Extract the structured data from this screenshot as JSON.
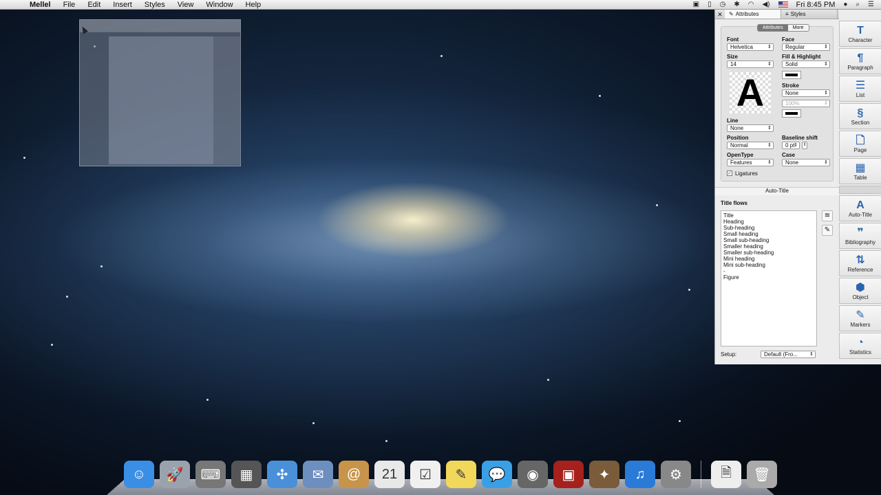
{
  "menubar": {
    "apple": "",
    "app_name": "Mellel",
    "menus": [
      "File",
      "Edit",
      "Insert",
      "Styles",
      "View",
      "Window",
      "Help"
    ],
    "clock": "Fri 8:45 PM"
  },
  "palette": {
    "tabs": {
      "attributes": "Attributes",
      "styles": "Styles"
    },
    "segment": {
      "attributes": "Attributes",
      "more": "More"
    },
    "font": {
      "label": "Font",
      "value": "Helvetica"
    },
    "face": {
      "label": "Face",
      "value": "Regular"
    },
    "size": {
      "label": "Size",
      "value": "14"
    },
    "fill": {
      "label": "Fill & Highlight",
      "value": "Solid"
    },
    "preview_letter": "A",
    "stroke": {
      "label": "Stroke",
      "value": "None",
      "percent": "100%"
    },
    "line": {
      "label": "Line",
      "value": "None"
    },
    "position": {
      "label": "Position",
      "value": "Normal"
    },
    "baseline": {
      "label": "Baseline shift",
      "value": "0 pt"
    },
    "opentype": {
      "label": "OpenType",
      "value": "Features"
    },
    "case": {
      "label": "Case",
      "value": "None"
    },
    "ligatures": {
      "label": "Ligatures",
      "checked": true
    },
    "auto_title": {
      "header": "Auto-Title",
      "flows_label": "Title flows",
      "flows": [
        "Title",
        "Heading",
        "Sub-heading",
        "Small heading",
        "Small sub-heading",
        "Smaller heading",
        "Smaller sub-heading",
        "Mini heading",
        "Mini sub-heading",
        "-",
        "Figure"
      ],
      "setup_label": "Setup:",
      "setup_value": "Default (Fro..."
    },
    "side_buttons_top": [
      {
        "icon": "T",
        "label": "Character"
      },
      {
        "icon": "¶",
        "label": "Paragraph"
      },
      {
        "icon": "☰",
        "label": "List"
      },
      {
        "icon": "§",
        "label": "Section"
      },
      {
        "icon": "🗋",
        "label": "Page"
      },
      {
        "icon": "▦",
        "label": "Table"
      }
    ],
    "side_buttons_bottom": [
      {
        "icon": "A",
        "label": "Auto-Title"
      },
      {
        "icon": "❞",
        "label": "Bibliography"
      },
      {
        "icon": "⇅",
        "label": "Reference"
      },
      {
        "icon": "⬢",
        "label": "Object"
      },
      {
        "icon": "✎",
        "label": "Markers"
      },
      {
        "icon": "◔",
        "label": "Statistics"
      }
    ]
  },
  "dock": {
    "items": [
      {
        "name": "finder",
        "color": "#3a8ee6",
        "glyph": "☺"
      },
      {
        "name": "launchpad",
        "color": "#9aa3ad",
        "glyph": "🚀"
      },
      {
        "name": "mellel",
        "color": "#777",
        "glyph": "⌨"
      },
      {
        "name": "mission-control",
        "color": "#555",
        "glyph": "▦"
      },
      {
        "name": "safari",
        "color": "#4a90d9",
        "glyph": "✣"
      },
      {
        "name": "mail",
        "color": "#6d8fbf",
        "glyph": "✉"
      },
      {
        "name": "contacts",
        "color": "#c8944a",
        "glyph": "@"
      },
      {
        "name": "calendar",
        "color": "#e8e8e8",
        "glyph": "21"
      },
      {
        "name": "reminders",
        "color": "#f0f0f0",
        "glyph": "☑"
      },
      {
        "name": "notes",
        "color": "#f2d85a",
        "glyph": "✎"
      },
      {
        "name": "messages",
        "color": "#3aa0e6",
        "glyph": "💬"
      },
      {
        "name": "facetime",
        "color": "#666",
        "glyph": "◉"
      },
      {
        "name": "photo-booth",
        "color": "#a6201c",
        "glyph": "▣"
      },
      {
        "name": "iphoto",
        "color": "#7a5b3a",
        "glyph": "✦"
      },
      {
        "name": "itunes",
        "color": "#2a7ad8",
        "glyph": "♫"
      },
      {
        "name": "system-preferences",
        "color": "#888",
        "glyph": "⚙"
      }
    ],
    "trailing": [
      {
        "name": "document",
        "color": "#eee",
        "glyph": "🗎"
      },
      {
        "name": "trash",
        "color": "#aaa",
        "glyph": "🗑"
      }
    ]
  }
}
